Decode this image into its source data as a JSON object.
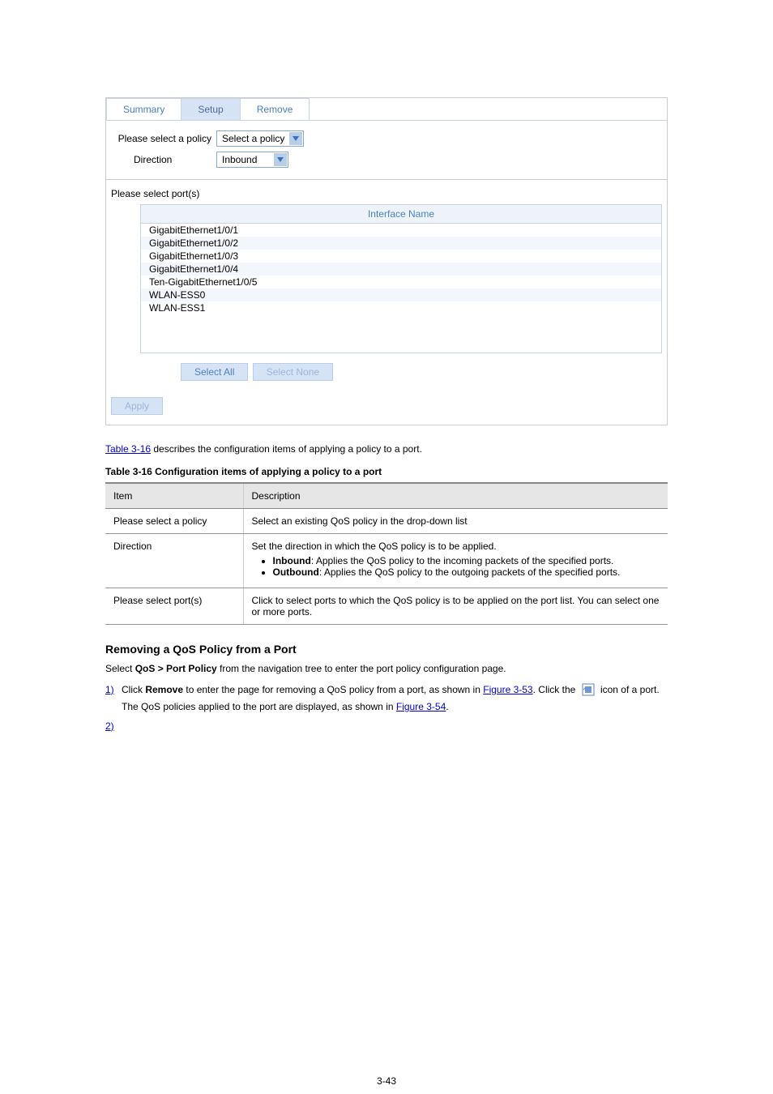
{
  "tabs": {
    "summary": "Summary",
    "setup": "Setup",
    "remove": "Remove"
  },
  "form": {
    "policy_label": "Please select a policy",
    "policy_value": "Select a policy",
    "direction_label": "Direction",
    "direction_value": "Inbound"
  },
  "ports": {
    "section_label": "Please select port(s)",
    "header": "Interface Name",
    "items": [
      "GigabitEthernet1/0/1",
      "GigabitEthernet1/0/2",
      "GigabitEthernet1/0/3",
      "GigabitEthernet1/0/4",
      "Ten-GigabitEthernet1/0/5",
      "WLAN-ESS0",
      "WLAN-ESS1"
    ],
    "select_all": "Select All",
    "select_none": "Select None",
    "apply": "Apply"
  },
  "text": {
    "after_fig": " describes the configuration items of applying a policy to a port.",
    "table_link": "Table 3-16",
    "table_caption": "Table 3-16 Configuration items of applying a policy to a port",
    "section_heading": "Removing a QoS Policy from a Port",
    "proc_intro_prefix": "Select ",
    "proc_intro_bold": "QoS > Port Policy",
    "proc_intro_suffix": " from the navigation tree to enter the port policy configuration page.",
    "step1_num": "1)",
    "step1_a": "Click ",
    "step1_b": "Remove",
    "step1_c": " to enter the page for removing a QoS policy from a port, as shown in ",
    "step1_link": "Figure 3-53",
    "step1_d": ". Click the ",
    "step1_e": " icon of a port. The QoS policies applied to the port are displayed, as shown in ",
    "step1_link2": "Figure 3-54",
    "step2_num": "2)"
  },
  "config_table": {
    "h1": "Item",
    "h2": "Description",
    "r1c1": "Please select a policy",
    "r1c2": "Select an existing QoS policy in the drop-down list",
    "r2c1": "Direction",
    "r2c2_intro": "Set the direction in which the QoS policy is to be applied.",
    "r2c2_b1_a": "Inbound",
    "r2c2_b1_b": ": Applies the QoS policy to the incoming packets of the specified ports.",
    "r2c2_b2_a": "Outbound",
    "r2c2_b2_b": ": Applies the QoS policy to the outgoing packets of the specified ports.",
    "r3c1": "Please select port(s)",
    "r3c2": "Click to select ports to which the QoS policy is to be applied on the port list. You can select one or more ports."
  },
  "page_num": "3-43"
}
